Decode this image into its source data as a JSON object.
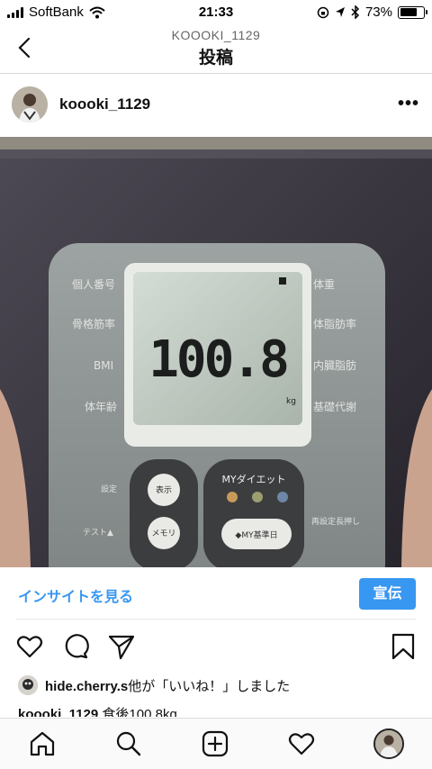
{
  "status_bar": {
    "carrier": "SoftBank",
    "time": "21:33",
    "battery": "73%",
    "battery_level": 0.73
  },
  "header": {
    "account": "KOOOKI_1129",
    "title": "投稿"
  },
  "post": {
    "username": "koooki_1129",
    "scale_reading": "100.8",
    "scale_unit": "kg",
    "scale_left_labels": [
      "個人番号",
      "骨格筋率",
      "BMI",
      "体年齢"
    ],
    "scale_right_labels": [
      "体重",
      "体脂肪率",
      "内臓脂肪",
      "基礎代謝"
    ],
    "scale_button_labels": [
      "設定",
      "テスト▲",
      "表示",
      "メモリ"
    ],
    "scale_diet_title": "MYダイエット",
    "scale_my_button": "◆MY基準日",
    "scale_side_note": "再設定長押し"
  },
  "insights": {
    "link_label": "インサイトを見る",
    "promote_label": "宣伝"
  },
  "likes": {
    "user": "hide.cherry.s",
    "suffix": "他が「いいね！」しました"
  },
  "caption": {
    "user": "koooki_1129",
    "text": "食後100.8kg"
  },
  "icons": {
    "nav": [
      "back-chevron-icon"
    ],
    "actions": [
      "heart-icon",
      "comment-icon",
      "share-icon",
      "bookmark-icon"
    ],
    "tabbar": [
      "home-icon",
      "search-icon",
      "new-post-icon",
      "activity-heart-icon",
      "profile-avatar"
    ]
  }
}
